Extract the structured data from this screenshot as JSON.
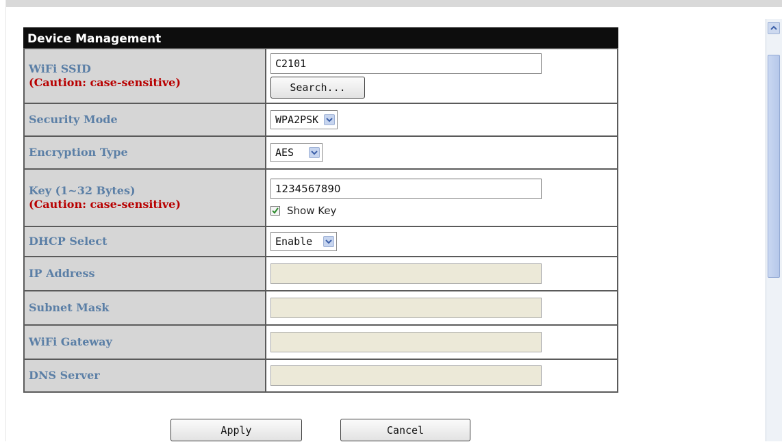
{
  "panel": {
    "title": "Device Management"
  },
  "fields": {
    "ssid": {
      "label": "WiFi SSID",
      "caution": "(Caution: case-sensitive)",
      "value": "C2101",
      "search_label": "Search..."
    },
    "security_mode": {
      "label": "Security Mode",
      "value": "WPA2PSK"
    },
    "encryption_type": {
      "label": "Encryption Type",
      "value": "AES"
    },
    "key": {
      "label": "Key (1~32 Bytes)",
      "caution": "(Caution: case-sensitive)",
      "value": "1234567890",
      "show_key_label": "Show Key",
      "show_key_checked": true
    },
    "dhcp": {
      "label": "DHCP Select",
      "value": "Enable"
    },
    "ip_address": {
      "label": "IP Address",
      "value": ""
    },
    "subnet_mask": {
      "label": "Subnet Mask",
      "value": ""
    },
    "gateway": {
      "label": "WiFi Gateway",
      "value": ""
    },
    "dns": {
      "label": "DNS Server",
      "value": ""
    }
  },
  "actions": {
    "apply_label": "Apply",
    "cancel_label": "Cancel"
  },
  "icons": {
    "dropdown": "chevron-down-icon",
    "check": "checkmark-icon",
    "scroll_up": "chevron-up-icon"
  },
  "colors": {
    "title_bar": "#0d0d0d",
    "label_text": "#5b7fa6",
    "caution_text": "#b80000",
    "label_bg": "#d6d6d6",
    "disabled_input": "#ece9d8"
  }
}
